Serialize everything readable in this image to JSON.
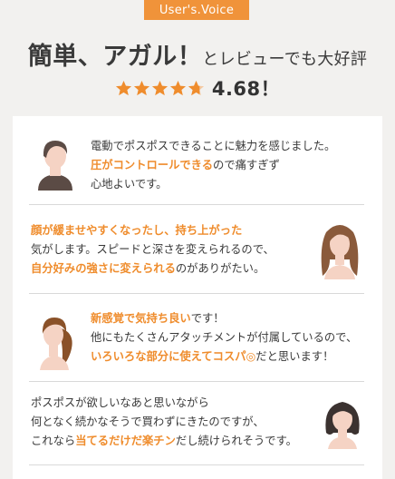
{
  "badge": "User's.Voice",
  "headline": {
    "big": "簡単、アガル！",
    "small": "とレビューでも大好評"
  },
  "rating": {
    "score": "4.68！",
    "full_stars": 4,
    "partial": true,
    "star_color": "#ef8c2c"
  },
  "reviews": [
    {
      "avatar": "short-hair-person-icon",
      "lines": [
        [
          {
            "t": "電動でポスポスできることに魅力を感じました。",
            "h": false
          }
        ],
        [
          {
            "t": "圧がコントロールできる",
            "h": true
          },
          {
            "t": "ので痛すぎず",
            "h": false
          }
        ],
        [
          {
            "t": "心地よいです。",
            "h": false
          }
        ]
      ]
    },
    {
      "avatar": "long-hair-woman-icon",
      "lines": [
        [
          {
            "t": "顔が緩ませやすくなったし、持ち上がった",
            "h": true
          }
        ],
        [
          {
            "t": "気がします。スピードと深さを変えられるので、",
            "h": false
          }
        ],
        [
          {
            "t": "自分好みの強さに変えられる",
            "h": true
          },
          {
            "t": "のがありがたい。",
            "h": false
          }
        ]
      ]
    },
    {
      "avatar": "ponytail-woman-icon",
      "lines": [
        [
          {
            "t": "新感覚で気持ち良い",
            "h": true
          },
          {
            "t": "です！",
            "h": false
          }
        ],
        [
          {
            "t": "他にもたくさんアタッチメントが付属しているので、",
            "h": false
          }
        ],
        [
          {
            "t": "いろいろな部分に使えてコスパ◎",
            "h": true
          },
          {
            "t": "だと思います！",
            "h": false
          }
        ]
      ]
    },
    {
      "avatar": "bob-hair-woman-icon",
      "lines": [
        [
          {
            "t": "ポスポスが欲しいなあと思いながら",
            "h": false
          }
        ],
        [
          {
            "t": "何となく続かなそうで買わずにきたのですが、",
            "h": false
          }
        ],
        [
          {
            "t": "これなら",
            "h": false
          },
          {
            "t": "当てるだけだ楽チン",
            "h": true
          },
          {
            "t": "だし続けられそうです。",
            "h": false
          }
        ]
      ]
    }
  ]
}
